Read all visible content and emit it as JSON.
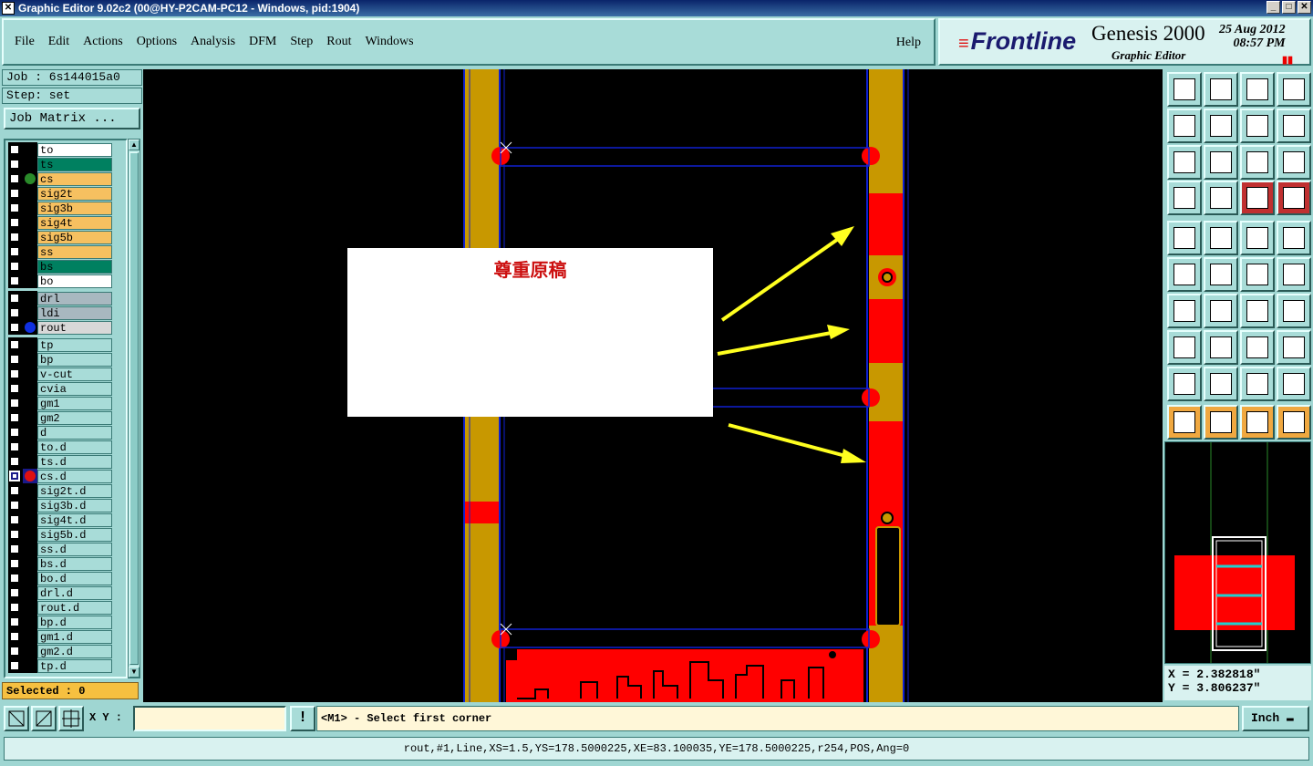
{
  "window": {
    "title": "Graphic Editor 9.02c2 (00@HY-P2CAM-PC12 - Windows, pid:1904)",
    "buttons": [
      "_",
      "□",
      "✕"
    ]
  },
  "menu": {
    "items": [
      "File",
      "Edit",
      "Actions",
      "Options",
      "Analysis",
      "DFM",
      "Step",
      "Rout",
      "Windows"
    ],
    "help": "Help"
  },
  "brand": {
    "logo": "Frontline",
    "product": "Genesis 2000",
    "subtitle": "Graphic Editor",
    "date": "25 Aug 2012",
    "time": "08:57 PM"
  },
  "job": {
    "job_line": "Job : 6s144015a0",
    "step_line": "Step: set",
    "matrix_button": "Job Matrix ..."
  },
  "layers": [
    {
      "name": "to",
      "color": "#ffffff",
      "dot": ""
    },
    {
      "name": "ts",
      "color": "#008060",
      "dot": ""
    },
    {
      "name": "cs",
      "color": "#f6c060",
      "dot": "#2a8a2a"
    },
    {
      "name": "sig2t",
      "color": "#f6c060",
      "dot": ""
    },
    {
      "name": "sig3b",
      "color": "#f6c060",
      "dot": ""
    },
    {
      "name": "sig4t",
      "color": "#f6c060",
      "dot": ""
    },
    {
      "name": "sig5b",
      "color": "#f6c060",
      "dot": ""
    },
    {
      "name": "ss",
      "color": "#f6c060",
      "dot": ""
    },
    {
      "name": "bs",
      "color": "#008060",
      "dot": ""
    },
    {
      "name": "bo",
      "color": "#ffffff",
      "dot": ""
    },
    {
      "name": "drl",
      "color": "#a8b8c0",
      "dot": "",
      "gap": true
    },
    {
      "name": "ldi",
      "color": "#a8b8c0",
      "dot": ""
    },
    {
      "name": "rout",
      "color": "#d8d8d8",
      "dot": "#1030e0"
    },
    {
      "name": "tp",
      "color": "#a8dcd8",
      "dot": "",
      "gap": true
    },
    {
      "name": "bp",
      "color": "#a8dcd8",
      "dot": ""
    },
    {
      "name": "v-cut",
      "color": "#a8dcd8",
      "dot": ""
    },
    {
      "name": "cvia",
      "color": "#a8dcd8",
      "dot": ""
    },
    {
      "name": "gm1",
      "color": "#a8dcd8",
      "dot": ""
    },
    {
      "name": "gm2",
      "color": "#a8dcd8",
      "dot": ""
    },
    {
      "name": "d",
      "color": "#a8dcd8",
      "dot": ""
    },
    {
      "name": "to.d",
      "color": "#a8dcd8",
      "dot": ""
    },
    {
      "name": "ts.d",
      "color": "#a8dcd8",
      "dot": ""
    },
    {
      "name": "cs.d",
      "color": "#a8dcd8",
      "dot": "#e01010",
      "sel": true
    },
    {
      "name": "sig2t.d",
      "color": "#a8dcd8",
      "dot": ""
    },
    {
      "name": "sig3b.d",
      "color": "#a8dcd8",
      "dot": ""
    },
    {
      "name": "sig4t.d",
      "color": "#a8dcd8",
      "dot": ""
    },
    {
      "name": "sig5b.d",
      "color": "#a8dcd8",
      "dot": ""
    },
    {
      "name": "ss.d",
      "color": "#a8dcd8",
      "dot": ""
    },
    {
      "name": "bs.d",
      "color": "#a8dcd8",
      "dot": ""
    },
    {
      "name": "bo.d",
      "color": "#a8dcd8",
      "dot": ""
    },
    {
      "name": "drl.d",
      "color": "#a8dcd8",
      "dot": ""
    },
    {
      "name": "rout.d",
      "color": "#a8dcd8",
      "dot": ""
    },
    {
      "name": "bp.d",
      "color": "#a8dcd8",
      "dot": ""
    },
    {
      "name": "gm1.d",
      "color": "#a8dcd8",
      "dot": ""
    },
    {
      "name": "gm2.d",
      "color": "#a8dcd8",
      "dot": ""
    },
    {
      "name": "tp.d",
      "color": "#a8dcd8",
      "dot": ""
    }
  ],
  "selected": "Selected : 0",
  "overlay": {
    "text": "尊重原稿"
  },
  "coords": {
    "x": "X = 2.382818\"",
    "y": "Y = 3.806237\""
  },
  "bottom": {
    "xy_label": "X Y :",
    "xy_value": "",
    "prompt": "<M1> - Select first corner",
    "unit": "Inch"
  },
  "status": "rout,#1,Line,XS=1.5,YS=178.5000225,XE=83.100035,YE=178.5000225,r254,POS,Ang=0",
  "colors": {
    "copper": "#c89800",
    "pad": "#ff0000",
    "rout": "#1020d0",
    "arrow": "#ffff20"
  }
}
